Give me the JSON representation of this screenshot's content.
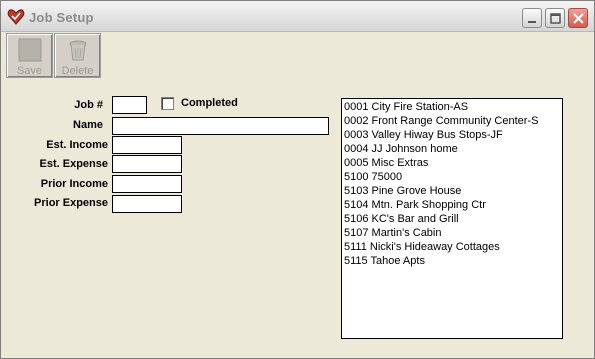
{
  "window": {
    "title": "Job Setup"
  },
  "toolbar": {
    "save_label": "Save",
    "delete_label": "Delete",
    "save_icon": "save-icon",
    "delete_icon": "trash-icon"
  },
  "form": {
    "job_number": {
      "label": "Job #",
      "value": ""
    },
    "completed": {
      "label": "Completed",
      "checked": false
    },
    "name": {
      "label": "Name",
      "value": ""
    },
    "est_income": {
      "label": "Est. Income",
      "value": ""
    },
    "est_expense": {
      "label": "Est. Expense",
      "value": ""
    },
    "prior_income": {
      "label": "Prior Income",
      "value": ""
    },
    "prior_expense": {
      "label": "Prior Expense",
      "value": ""
    }
  },
  "job_list": [
    "0001 City Fire Station-AS",
    "0002 Front Range Community Center-S",
    "0003 Valley Hiway Bus Stops-JF",
    "0004 JJ Johnson home",
    "0005 Misc Extras",
    "5100 75000",
    "5103 Pine Grove House",
    "5104 Mtn. Park Shopping Ctr",
    "5106 KC's Bar and Grill",
    "5107 Martin's Cabin",
    "5111 Nicki's Hideaway Cottages",
    "5115 Tahoe Apts"
  ]
}
